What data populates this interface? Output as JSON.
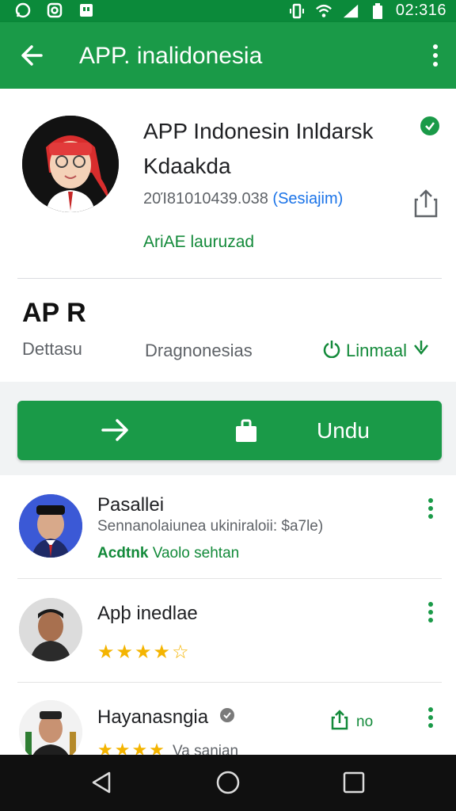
{
  "status_bar": {
    "time": "02:316",
    "icons": [
      "whatsapp-icon",
      "instagram-icon",
      "notification-icon",
      "vibrate-icon",
      "wifi-icon",
      "signal-icon",
      "battery-icon"
    ]
  },
  "app_bar": {
    "title": "APP. inalidonesia",
    "back_icon": "arrow-back-icon",
    "menu_icon": "more-vertical-icon"
  },
  "app": {
    "name": "APP Indonesin Inldarsk Kdaakda",
    "meta": "20Ί81010439.038",
    "meta_link": "(Sesiajim)",
    "badge_text": "AriAE lauruzad",
    "short_title": "AP R",
    "stats": {
      "left": "Dettasu",
      "middle": "Dragnonesias",
      "right": "Linmaal"
    },
    "colors": {
      "accent": "#1a9a48",
      "status_bar": "#0b8a3a",
      "link": "#1a73e8",
      "star": "#f4b400"
    }
  },
  "install_button": {
    "label": "Undu"
  },
  "reviews": [
    {
      "name": "Pasallei",
      "subtitle": "Sennanolaiunea ukiniraloii: $a7le)",
      "rating_text": "Vaolo sehtan",
      "stars_label": "Acdtnk"
    },
    {
      "name": "Apþ inedlae",
      "rating": 4,
      "stars": "★★★★☆"
    },
    {
      "name": "Hayanasngia",
      "link_text": "no",
      "rating_text": "Va sanjan",
      "stars": "★★★★"
    }
  ],
  "nav_bar": {
    "icons": [
      "nav-back-icon",
      "nav-home-icon",
      "nav-recents-icon"
    ]
  }
}
